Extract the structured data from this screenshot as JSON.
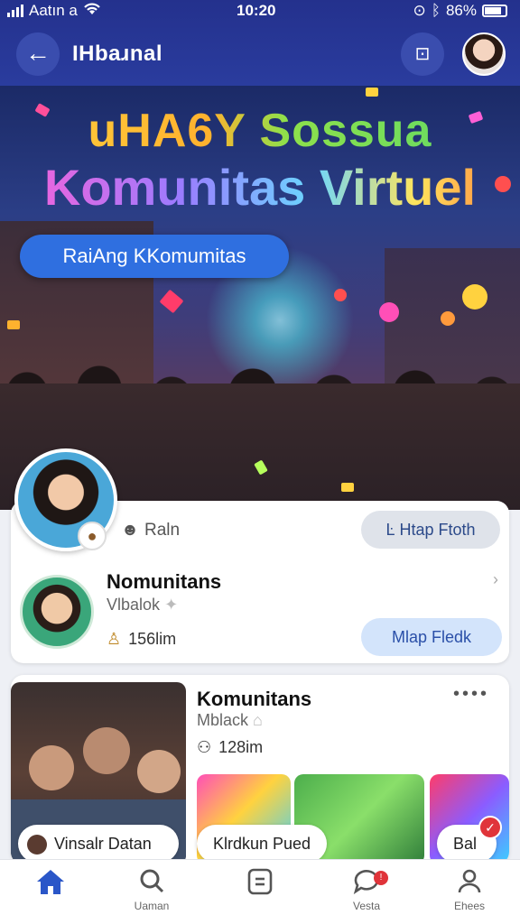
{
  "status_bar": {
    "carrier": "Aatın a",
    "time": "10:20",
    "battery_text": "86%"
  },
  "header": {
    "title": "IHbaɹnal",
    "back_icon": "arrow-left-icon",
    "qr_icon": "qr-code-icon"
  },
  "hero": {
    "title_line1": "uHA6Y Sossua",
    "title_line2": "Komunitas Virtuel",
    "pill_label": "RaiAng KKomumitas"
  },
  "card1": {
    "owner_name": "Raln",
    "owner_button": "Ŀ Htap Ftoth",
    "item_title": "Nomunitans",
    "item_subtitle": "Vlbalok",
    "item_stat": "156lim",
    "item_button": "Mlap Fledk"
  },
  "card2": {
    "title": "Komunitans",
    "subtitle": "Mblack",
    "stat": "128im",
    "chips": [
      {
        "label": "Vinsalr Datan"
      },
      {
        "label": "Klrdkun Pued"
      },
      {
        "label": "Bal"
      }
    ]
  },
  "bottom_nav": {
    "items": [
      {
        "label": "",
        "icon": "home-icon"
      },
      {
        "label": "Uaman",
        "icon": "search-icon"
      },
      {
        "label": "",
        "icon": "tablet-icon"
      },
      {
        "label": "Vesta",
        "icon": "chat-icon"
      },
      {
        "label": "Ehees",
        "icon": "profile-icon"
      }
    ],
    "active_color": "#2a56c8"
  },
  "colors": {
    "header_bg": "#24318d",
    "pill_blue": "#2f6fe0",
    "badge_red": "#e0343a"
  }
}
